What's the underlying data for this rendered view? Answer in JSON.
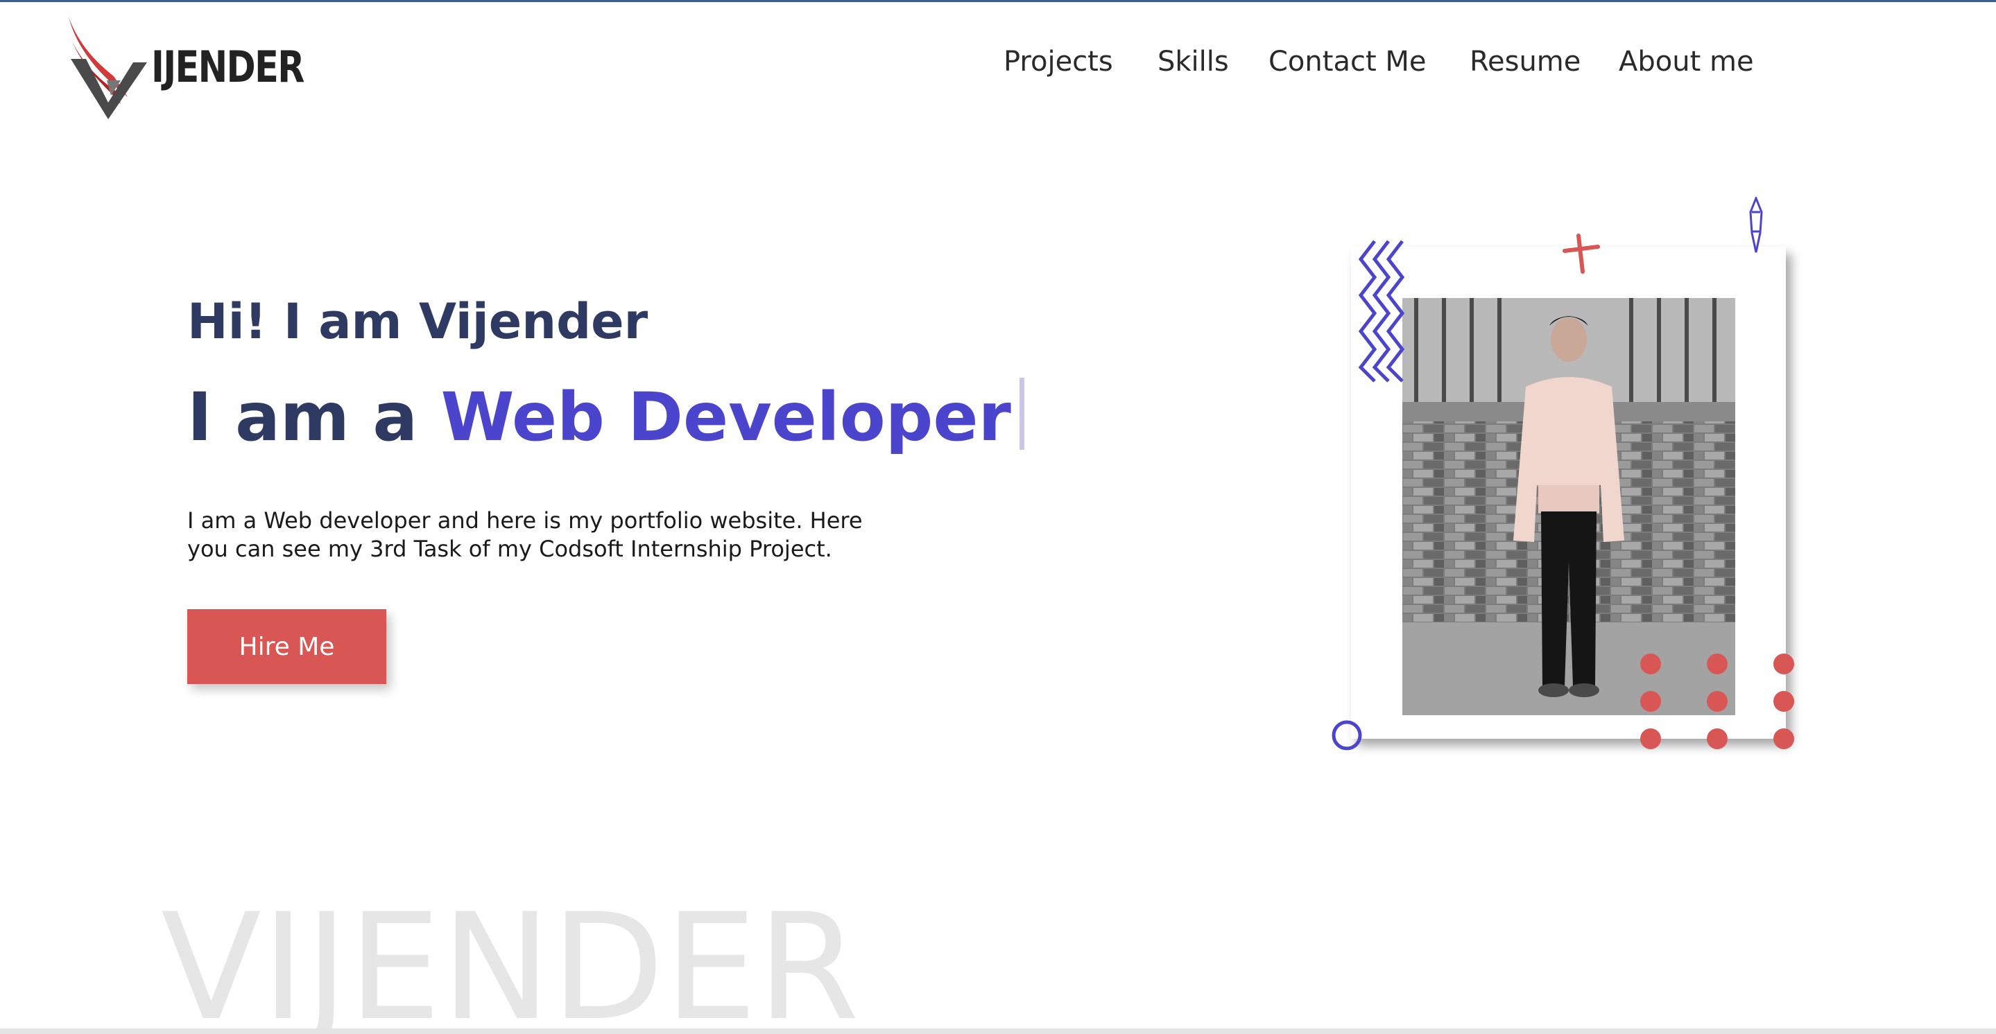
{
  "brand": {
    "logo_text": "IJENDER",
    "logo_alt": "V"
  },
  "nav": {
    "items": [
      {
        "label": "Projects"
      },
      {
        "label": "Skills"
      },
      {
        "label": "Contact Me"
      },
      {
        "label": "Resume"
      },
      {
        "label": "About me"
      }
    ]
  },
  "hero": {
    "greeting": "Hi! I am Vijender",
    "role_prefix": "I am a ",
    "role_highlight": "Web Developer",
    "description": "I am a Web developer and here is my portfolio website. Here you can see my 3rd Task of my Codsoft Internship Project.",
    "cta_label": "Hire Me"
  },
  "watermark": "VIJENDER",
  "colors": {
    "accent_purple": "#4b44cc",
    "accent_red": "#d85654",
    "heading_navy": "#2f3a63"
  }
}
